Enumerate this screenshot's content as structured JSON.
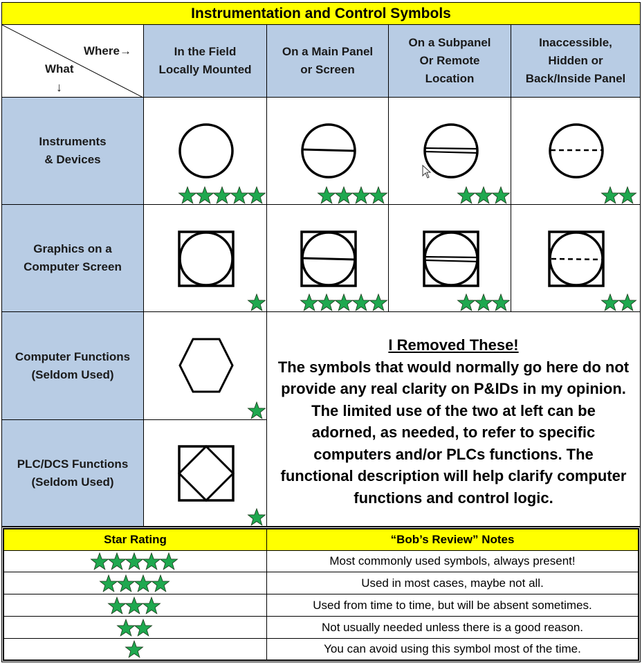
{
  "title": "Instrumentation and Control Symbols",
  "corner": {
    "where_label": "Where→",
    "what_label": "What",
    "down_arrow": "↓"
  },
  "columns": [
    {
      "label": "In the Field\nLocally Mounted"
    },
    {
      "label": "On a Main Panel\nor Screen"
    },
    {
      "label": "On a Subpanel\nOr Remote\nLocation"
    },
    {
      "label": "Inaccessible,\nHidden or\nBack/Inside Panel"
    }
  ],
  "rows": [
    {
      "label": "Instruments\n& Devices",
      "cells": [
        {
          "symbol": "circle",
          "stars": 5
        },
        {
          "symbol": "circle-single-line",
          "stars": 4
        },
        {
          "symbol": "circle-double-line",
          "stars": 3
        },
        {
          "symbol": "circle-dashed-line",
          "stars": 2
        }
      ]
    },
    {
      "label": "Graphics on a\nComputer Screen",
      "cells": [
        {
          "symbol": "square-circle",
          "stars": 1
        },
        {
          "symbol": "square-circle-single-line",
          "stars": 5
        },
        {
          "symbol": "square-circle-double-line",
          "stars": 3
        },
        {
          "symbol": "square-circle-dashed-line",
          "stars": 2
        }
      ]
    },
    {
      "label": "Computer Functions\n(Seldom Used)",
      "cells": [
        {
          "symbol": "hexagon",
          "stars": 1
        }
      ]
    },
    {
      "label": "PLC/DCS Functions\n(Seldom Used)",
      "cells": [
        {
          "symbol": "square-diamond",
          "stars": 1
        }
      ]
    }
  ],
  "removed_note": {
    "title": "I Removed These!",
    "lines": [
      "The symbols that would normally go here do not",
      "provide any real clarity on P&IDs in my opinion.",
      "The limited use of the two at left can be",
      "adorned, as needed, to refer to specific",
      "computers and/or PLCs functions. The",
      "functional description will help clarify computer",
      "functions and control logic."
    ]
  },
  "legend": {
    "header_rating": "Star Rating",
    "header_notes": "“Bob’s Review” Notes",
    "rows": [
      {
        "stars": 5,
        "note": "Most commonly used symbols, always present!"
      },
      {
        "stars": 4,
        "note": "Used in most cases, maybe not all."
      },
      {
        "stars": 3,
        "note": "Used from time to time, but will be absent sometimes."
      },
      {
        "stars": 2,
        "note": "Not usually needed unless there is a good reason."
      },
      {
        "stars": 1,
        "note": "You can avoid using this symbol most of the time."
      }
    ]
  },
  "colors": {
    "header_blue": "#b8cce4",
    "title_yellow": "#ffff00",
    "star_green": "#1fa84f"
  }
}
